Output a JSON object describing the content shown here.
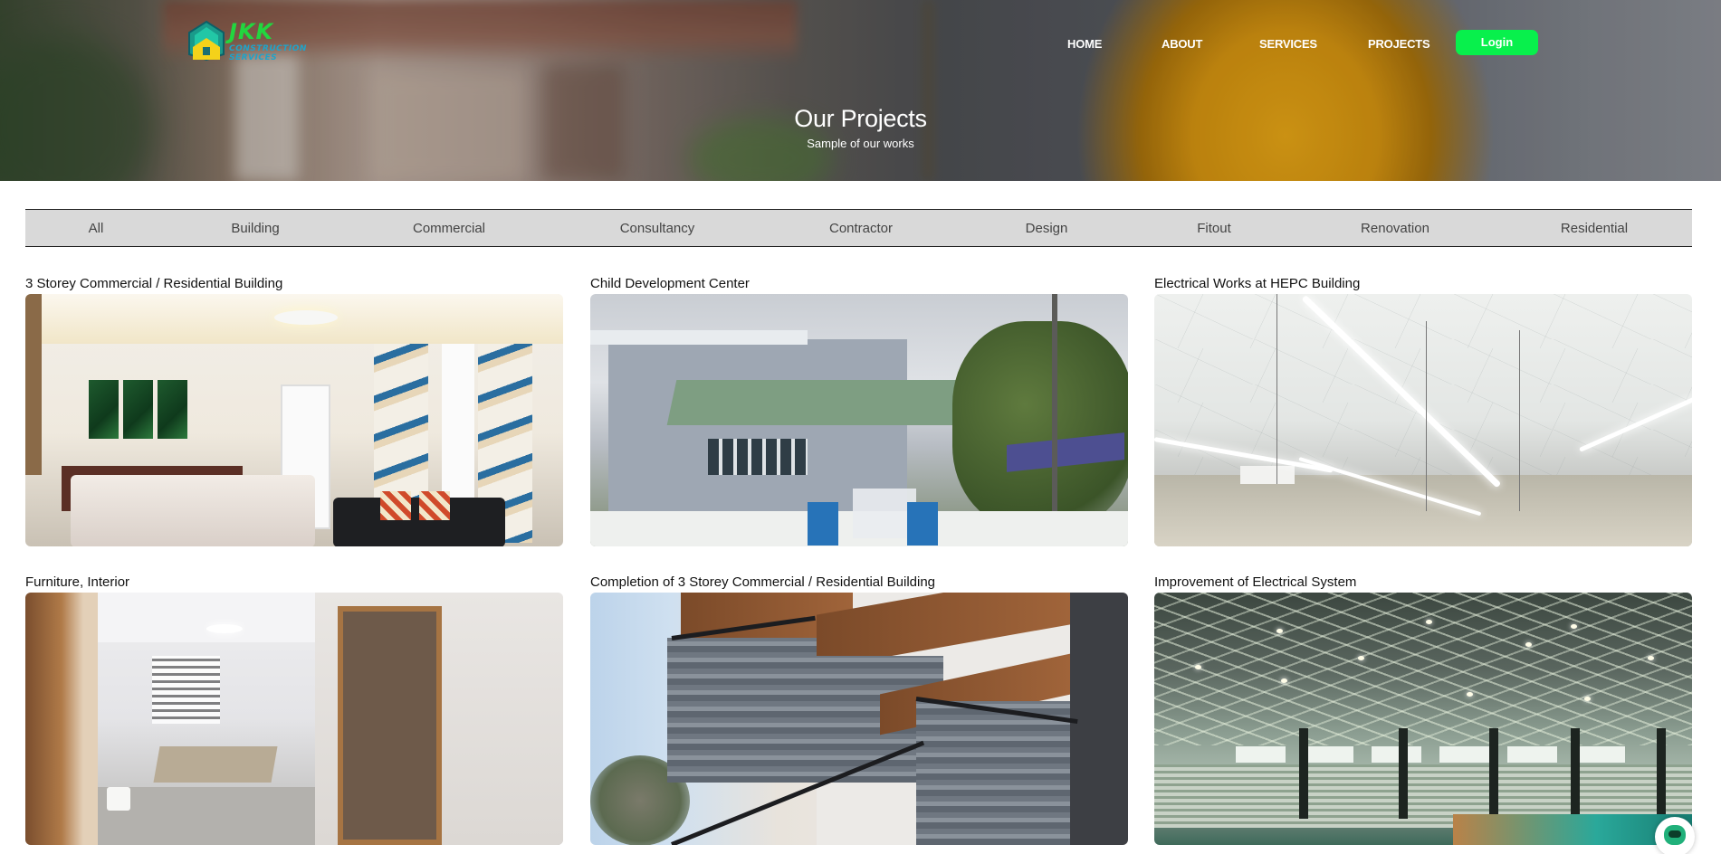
{
  "logo": {
    "brand": "JKK",
    "line1": "CONSTRUCTION",
    "line2": "SERVICES"
  },
  "nav": {
    "home": "HOME",
    "about": "ABOUT",
    "services": "SERVICES",
    "projects": "PROJECTS",
    "login": "Login"
  },
  "hero": {
    "title": "Our Projects",
    "subtitle": "Sample of our works"
  },
  "filters": [
    "All",
    "Building",
    "Commercial",
    "Consultancy",
    "Contractor",
    "Design",
    "Fitout",
    "Renovation",
    "Residential"
  ],
  "projects": [
    {
      "title": "3 Storey Commercial / Residential Building"
    },
    {
      "title": "Child Development Center"
    },
    {
      "title": "Electrical Works at HEPC Building"
    },
    {
      "title": "Furniture, Interior"
    },
    {
      "title": "Completion of 3 Storey Commercial / Residential Building"
    },
    {
      "title": "Improvement of Electrical System"
    }
  ],
  "colors": {
    "accent": "#08f04c",
    "logo_green": "#22d63f",
    "logo_blue": "#1fa3c9",
    "filter_bg": "#d9d9d9"
  },
  "icons": {
    "chat": "chat-bot-icon",
    "logo": "house-logo-icon"
  }
}
